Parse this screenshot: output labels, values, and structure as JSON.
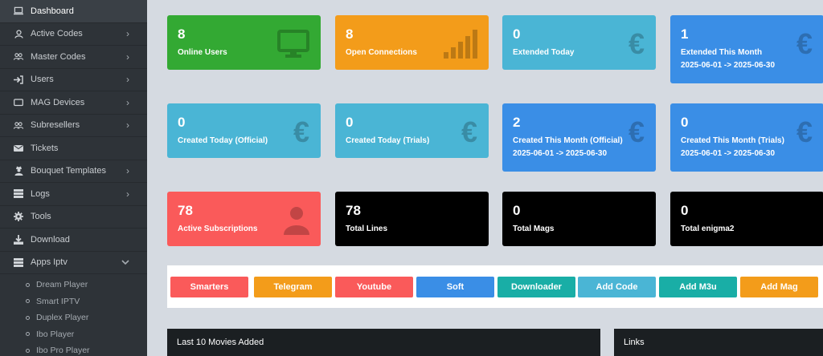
{
  "sidebar": {
    "items": [
      {
        "label": "Dashboard",
        "icon": "laptop-icon",
        "chevron": false,
        "active": true
      },
      {
        "label": "Active Codes",
        "icon": "user-icon",
        "chevron": true
      },
      {
        "label": "Master Codes",
        "icon": "users-icon",
        "chevron": true
      },
      {
        "label": "Users",
        "icon": "sign-in-icon",
        "chevron": true
      },
      {
        "label": "MAG Devices",
        "icon": "tv-icon",
        "chevron": true
      },
      {
        "label": "Subresellers",
        "icon": "users-icon",
        "chevron": true
      },
      {
        "label": "Tickets",
        "icon": "envelope-icon",
        "chevron": false
      },
      {
        "label": "Bouquet Templates",
        "icon": "user-secret-icon",
        "chevron": true
      },
      {
        "label": "Logs",
        "icon": "server-icon",
        "chevron": true
      },
      {
        "label": "Tools",
        "icon": "gear-icon",
        "chevron": false
      },
      {
        "label": "Download",
        "icon": "download-icon",
        "chevron": false
      },
      {
        "label": "Apps Iptv",
        "icon": "server-icon",
        "chevron": true,
        "expanded": true
      }
    ],
    "sub_items": [
      "Dream Player",
      "Smart IPTV",
      "Duplex Player",
      "Ibo Player",
      "Ibo Pro Player"
    ]
  },
  "cards": {
    "online_users": {
      "value": "8",
      "label": "Online Users"
    },
    "open_connections": {
      "value": "8",
      "label": "Open Connections"
    },
    "extended_today": {
      "value": "0",
      "label": "Extended Today"
    },
    "extended_month": {
      "value": "1",
      "label": "Extended This Month",
      "range": "2025-06-01 -> 2025-06-30"
    },
    "created_today_official": {
      "value": "0",
      "label": "Created Today (Official)"
    },
    "created_today_trials": {
      "value": "0",
      "label": "Created Today (Trials)"
    },
    "created_month_official": {
      "value": "2",
      "label": "Created This Month (Official)",
      "range": "2025-06-01 -> 2025-06-30"
    },
    "created_month_trials": {
      "value": "0",
      "label": "Created This Month (Trials)",
      "range": "2025-06-01 -> 2025-06-30"
    },
    "active_subscriptions": {
      "value": "78",
      "label": "Active Subscriptions"
    },
    "total_lines": {
      "value": "78",
      "label": "Total Lines"
    },
    "total_mags": {
      "value": "0",
      "label": "Total Mags"
    },
    "total_enigma2": {
      "value": "0",
      "label": "Total enigma2"
    }
  },
  "quick_buttons": [
    "Smarters",
    "Telegram",
    "Youtube",
    "Soft",
    "Downloader",
    "Add Code",
    "Add M3u",
    "Add Mag"
  ],
  "panels": {
    "movies_title": "Last 10 Movies Added",
    "links_title": "Links"
  },
  "colors": {
    "green": "#33a933",
    "orange": "#f39c1a",
    "teal": "#4ab5d5",
    "blue": "#3a8ee6",
    "red": "#fa5a5a",
    "black": "#000000",
    "sidebar": "#2e3338",
    "page": "#d5dae1"
  }
}
